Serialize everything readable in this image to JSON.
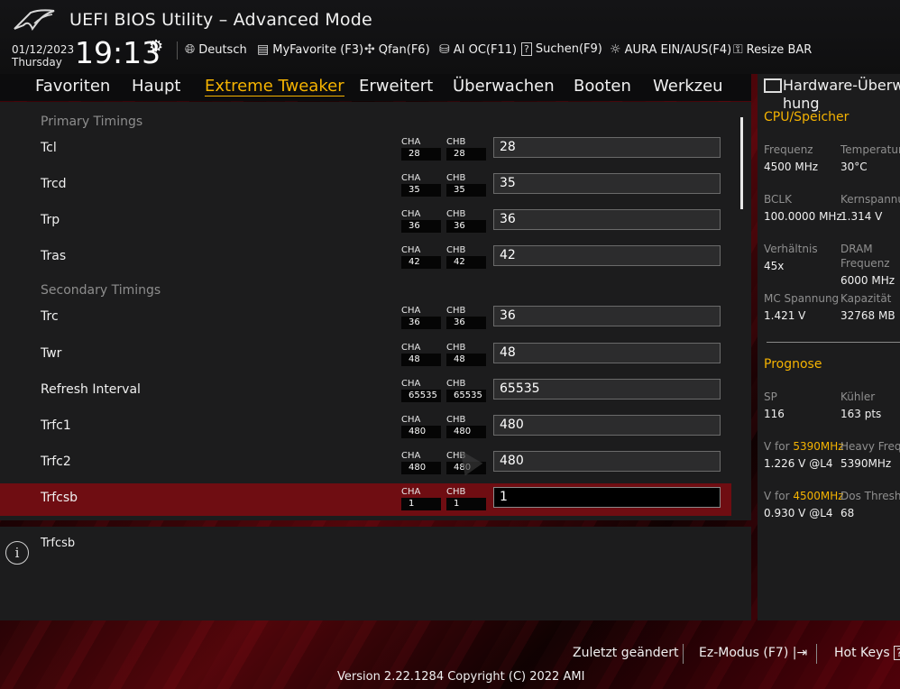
{
  "header": {
    "title": "UEFI BIOS Utility – Advanced Mode",
    "date": "01/12/2023",
    "day": "Thursday",
    "time": "19:13",
    "tools": [
      {
        "icon": "globe-icon",
        "label": "Deutsch"
      },
      {
        "icon": "favorite-icon",
        "label": "MyFavorite (F3)"
      },
      {
        "icon": "fan-icon",
        "label": "Qfan(F6)"
      },
      {
        "icon": "ai-oc-icon",
        "label": "AI OC(F11)"
      },
      {
        "icon": "search-help-icon",
        "label": "Suchen(F9)"
      },
      {
        "icon": "aura-icon",
        "label": "AURA EIN/AUS(F4)"
      },
      {
        "icon": "resize-bar-icon",
        "label": "Resize BAR"
      }
    ]
  },
  "tabs": [
    {
      "label": "Favoriten"
    },
    {
      "label": "Haupt"
    },
    {
      "label": "Extreme Tweaker",
      "active": true
    },
    {
      "label": "Erweitert"
    },
    {
      "label": "Überwachen"
    },
    {
      "label": "Booten"
    },
    {
      "label": "Werkzeu"
    }
  ],
  "main": {
    "primary_heading": "Primary Timings",
    "secondary_heading": "Secondary Timings",
    "rows": [
      {
        "label": "Tcl",
        "cha_label": "CHA",
        "cha": "28",
        "chb_label": "CHB",
        "chb": "28",
        "value": "28"
      },
      {
        "label": "Trcd",
        "cha_label": "CHA",
        "cha": "35",
        "chb_label": "CHB",
        "chb": "35",
        "value": "35"
      },
      {
        "label": "Trp",
        "cha_label": "CHA",
        "cha": "36",
        "chb_label": "CHB",
        "chb": "36",
        "value": "36"
      },
      {
        "label": "Tras",
        "cha_label": "CHA",
        "cha": "42",
        "chb_label": "CHB",
        "chb": "42",
        "value": "42"
      },
      {
        "label": "Trc",
        "cha_label": "CHA",
        "cha": "36",
        "chb_label": "CHB",
        "chb": "36",
        "value": "36"
      },
      {
        "label": "Twr",
        "cha_label": "CHA",
        "cha": "48",
        "chb_label": "CHB",
        "chb": "48",
        "value": "48"
      },
      {
        "label": "Refresh Interval",
        "cha_label": "CHA",
        "cha": "65535",
        "chb_label": "CHB",
        "chb": "65535",
        "value": "65535"
      },
      {
        "label": "Trfc1",
        "cha_label": "CHA",
        "cha": "480",
        "chb_label": "CHB",
        "chb": "480",
        "value": "480"
      },
      {
        "label": "Trfc2",
        "cha_label": "CHA",
        "cha": "480",
        "chb_label": "CHB",
        "chb": "480",
        "value": "480"
      },
      {
        "label": "Trfcsb",
        "cha_label": "CHA",
        "cha": "1",
        "chb_label": "CHB",
        "chb": "1",
        "value": "1",
        "selected": true
      }
    ]
  },
  "help": {
    "text": "Trfcsb"
  },
  "hardware_monitor": {
    "title_line1": "Hardware-Überwa",
    "title_line2": "hung",
    "cpu_section": "CPU/Speicher",
    "cpu_items": [
      {
        "label": "Frequenz",
        "value": "4500 MHz"
      },
      {
        "label": "Temperatur",
        "value": "30°C"
      },
      {
        "label": "BCLK",
        "value": "100.0000 MHz"
      },
      {
        "label": "Kernspannung",
        "value": "1.314 V"
      },
      {
        "label": "Verhältnis",
        "value": "45x"
      },
      {
        "label_line1": "DRAM",
        "label_line2": "Frequenz",
        "value": "6000 MHz"
      },
      {
        "label": "MC Spannung",
        "value": "1.421 V"
      },
      {
        "label": "Kapazität",
        "value": "32768 MB"
      }
    ],
    "forecast_section": "Prognose",
    "forecast_items": [
      {
        "label": "SP",
        "value": "116"
      },
      {
        "label": "Kühler",
        "value": "163 pts"
      },
      {
        "label_prefix": "V for ",
        "label_highlight": "5390MHz",
        "value": "1.226 V @L4"
      },
      {
        "label": "Heavy Freq",
        "value": "5390MHz"
      },
      {
        "label_prefix": "V for ",
        "label_highlight": "4500MHz",
        "value": "0.930 V @L4"
      },
      {
        "label": "Dos Thresh",
        "value": "68"
      }
    ]
  },
  "footer": {
    "last_changed": "Zuletzt geändert",
    "ez_mode": "Ez-Modus (F7)",
    "ez_mode_icon": "exit-arrow-icon",
    "hot_keys": "Hot Keys",
    "hot_keys_icon": "question-icon",
    "version": "Version 2.22.1284 Copyright (C) 2022 AMI"
  }
}
